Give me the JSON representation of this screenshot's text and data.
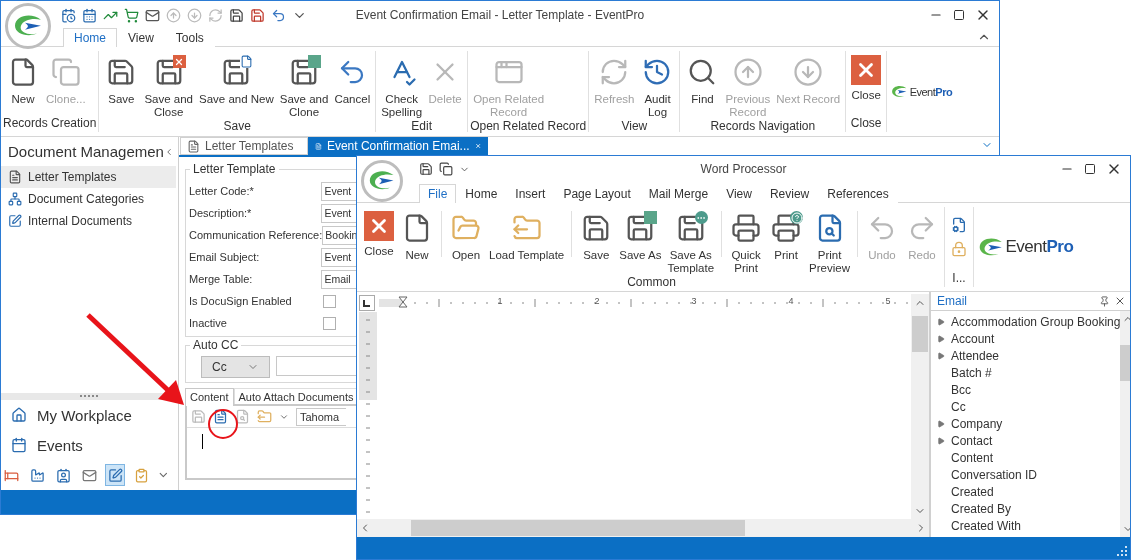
{
  "main_window": {
    "title": "Event Confirmation Email - Letter Template - EventPro",
    "ribbon_tabs": [
      {
        "label": "Home",
        "selected": true
      },
      {
        "label": "View",
        "selected": false
      },
      {
        "label": "Tools",
        "selected": false
      }
    ],
    "ribbon_groups": [
      {
        "label": "Records Creation",
        "buttons": [
          {
            "label": "New",
            "kind": "new",
            "disabled": false
          },
          {
            "label": "Clone...",
            "kind": "clone",
            "disabled": true
          }
        ]
      },
      {
        "label": "Save",
        "buttons": [
          {
            "label": "Save",
            "kind": "save",
            "disabled": false
          },
          {
            "label": "Save and\nClose",
            "kind": "save_close",
            "disabled": false
          },
          {
            "label": "Save and New",
            "kind": "save_new",
            "disabled": false
          },
          {
            "label": "Save and\nClone",
            "kind": "save_clone",
            "disabled": false
          },
          {
            "label": "Cancel",
            "kind": "cancel",
            "disabled": false
          }
        ]
      },
      {
        "label": "Edit",
        "buttons": [
          {
            "label": "Check\nSpelling",
            "kind": "spell",
            "disabled": false
          },
          {
            "label": "Delete",
            "kind": "delete",
            "disabled": true
          }
        ]
      },
      {
        "label": "Open Related Record",
        "buttons": [
          {
            "label": "Open Related\nRecord",
            "kind": "related",
            "disabled": true
          }
        ]
      },
      {
        "label": "View",
        "buttons": [
          {
            "label": "Refresh",
            "kind": "refresh",
            "disabled": true
          },
          {
            "label": "Audit\nLog",
            "kind": "audit",
            "disabled": false
          }
        ]
      },
      {
        "label": "Records Navigation",
        "buttons": [
          {
            "label": "Find",
            "kind": "find",
            "disabled": false
          },
          {
            "label": "Previous\nRecord",
            "kind": "prev",
            "disabled": true
          },
          {
            "label": "Next Record",
            "kind": "next",
            "disabled": true
          }
        ]
      },
      {
        "label": "Close",
        "buttons": [
          {
            "label": "Close",
            "kind": "close",
            "disabled": false
          }
        ]
      }
    ],
    "logo": "Event**Pro**",
    "sidebar": {
      "title": "Document Managemen",
      "items": [
        {
          "label": "Letter Templates",
          "kind": "document",
          "selected": true
        },
        {
          "label": "Document Categories",
          "kind": "hierarchy",
          "selected": false
        },
        {
          "label": "Internal Documents",
          "kind": "edit",
          "selected": false
        }
      ],
      "nav": [
        {
          "label": "My Workplace",
          "kind": "home"
        },
        {
          "label": "Events",
          "kind": "calendar"
        }
      ],
      "shortcuts": [
        {
          "kind": "bed",
          "selected": false
        },
        {
          "kind": "factory",
          "selected": false
        },
        {
          "kind": "contact",
          "selected": false
        },
        {
          "kind": "mail",
          "selected": false
        },
        {
          "kind": "edit",
          "selected": true
        },
        {
          "kind": "clipboard",
          "selected": false
        }
      ]
    },
    "document_tabs": [
      {
        "label": "Letter Templates",
        "selected": false
      },
      {
        "label": "Event Confirmation Emai...",
        "selected": true
      }
    ],
    "form": {
      "group": "Letter Template",
      "fields": [
        {
          "label": "Letter Code:*",
          "kind": "text",
          "value": "Event"
        },
        {
          "label": "Description:*",
          "kind": "text",
          "value": "Event"
        },
        {
          "label": "Communication Reference:",
          "kind": "text",
          "value": "Bookin"
        },
        {
          "label": "Email Subject:",
          "kind": "text",
          "value": "Event"
        },
        {
          "label": "Merge Table:",
          "kind": "text",
          "value": "Email"
        },
        {
          "label": "Is DocuSign Enabled",
          "kind": "checkbox",
          "checked": false
        },
        {
          "label": "Inactive",
          "kind": "checkbox",
          "checked": false
        }
      ]
    },
    "auto_cc": {
      "group": "Auto CC",
      "dropdown": "Cc"
    },
    "content_tabs": [
      {
        "label": "Content",
        "selected": true
      },
      {
        "label": "Auto Attach Documents",
        "selected": false
      }
    ],
    "font_box": "Tahoma"
  },
  "word_processor": {
    "title": "Word Processor",
    "ribbon_tabs": [
      {
        "label": "File",
        "selected": true
      },
      {
        "label": "Home",
        "selected": false
      },
      {
        "label": "Insert",
        "selected": false
      },
      {
        "label": "Page Layout",
        "selected": false
      },
      {
        "label": "Mail Merge",
        "selected": false
      },
      {
        "label": "View",
        "selected": false
      },
      {
        "label": "Review",
        "selected": false
      },
      {
        "label": "References",
        "selected": false
      }
    ],
    "group": {
      "label": "Common",
      "sections": [
        [
          {
            "label": "Close",
            "kind": "close",
            "disabled": false
          },
          {
            "label": "New",
            "kind": "new",
            "disabled": false
          }
        ],
        [
          {
            "label": "Open",
            "kind": "open",
            "disabled": false
          },
          {
            "label": "Load Template",
            "kind": "load_template",
            "disabled": false
          }
        ],
        [
          {
            "label": "Save",
            "kind": "save",
            "disabled": false
          },
          {
            "label": "Save As",
            "kind": "save_as",
            "disabled": false
          },
          {
            "label": "Save As\nTemplate",
            "kind": "save_as_template",
            "disabled": false
          }
        ],
        [
          {
            "label": "Quick\nPrint",
            "kind": "quick_print",
            "disabled": false
          },
          {
            "label": "Print",
            "kind": "print",
            "disabled": false
          },
          {
            "label": "Print\nPreview",
            "kind": "print_preview",
            "disabled": false
          }
        ],
        [
          {
            "label": "Undo",
            "kind": "undo",
            "disabled": true
          },
          {
            "label": "Redo",
            "kind": "redo",
            "disabled": true
          }
        ]
      ]
    },
    "small_group": {
      "label": "I..."
    },
    "logo": "Event**Pro**",
    "ruler_marks": [
      "1",
      "2",
      "3",
      "4",
      "5"
    ],
    "field_list": {
      "title": "Email",
      "items": [
        {
          "label": "Accommodation Group Booking",
          "expandable": true
        },
        {
          "label": "Account",
          "expandable": true
        },
        {
          "label": "Attendee",
          "expandable": true
        },
        {
          "label": "Batch #",
          "expandable": false
        },
        {
          "label": "Bcc",
          "expandable": false
        },
        {
          "label": "Cc",
          "expandable": false
        },
        {
          "label": "Company",
          "expandable": true
        },
        {
          "label": "Contact",
          "expandable": true
        },
        {
          "label": "Content",
          "expandable": false
        },
        {
          "label": "Conversation ID",
          "expandable": false
        },
        {
          "label": "Created",
          "expandable": false
        },
        {
          "label": "Created By",
          "expandable": false
        },
        {
          "label": "Created With",
          "expandable": false
        }
      ]
    }
  }
}
